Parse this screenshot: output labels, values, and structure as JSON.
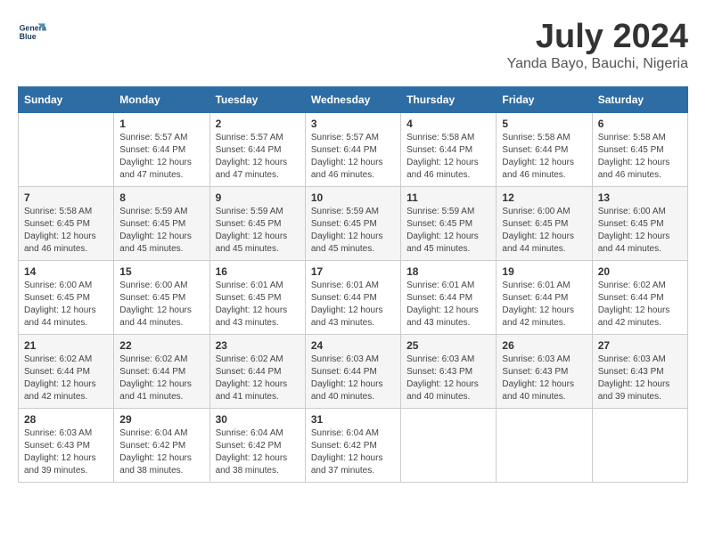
{
  "header": {
    "logo_line1": "General",
    "logo_line2": "Blue",
    "month_year": "July 2024",
    "location": "Yanda Bayo, Bauchi, Nigeria"
  },
  "weekdays": [
    "Sunday",
    "Monday",
    "Tuesday",
    "Wednesday",
    "Thursday",
    "Friday",
    "Saturday"
  ],
  "weeks": [
    [
      {
        "day": "",
        "sunrise": "",
        "sunset": "",
        "daylight": ""
      },
      {
        "day": "1",
        "sunrise": "Sunrise: 5:57 AM",
        "sunset": "Sunset: 6:44 PM",
        "daylight": "Daylight: 12 hours and 47 minutes."
      },
      {
        "day": "2",
        "sunrise": "Sunrise: 5:57 AM",
        "sunset": "Sunset: 6:44 PM",
        "daylight": "Daylight: 12 hours and 47 minutes."
      },
      {
        "day": "3",
        "sunrise": "Sunrise: 5:57 AM",
        "sunset": "Sunset: 6:44 PM",
        "daylight": "Daylight: 12 hours and 46 minutes."
      },
      {
        "day": "4",
        "sunrise": "Sunrise: 5:58 AM",
        "sunset": "Sunset: 6:44 PM",
        "daylight": "Daylight: 12 hours and 46 minutes."
      },
      {
        "day": "5",
        "sunrise": "Sunrise: 5:58 AM",
        "sunset": "Sunset: 6:44 PM",
        "daylight": "Daylight: 12 hours and 46 minutes."
      },
      {
        "day": "6",
        "sunrise": "Sunrise: 5:58 AM",
        "sunset": "Sunset: 6:45 PM",
        "daylight": "Daylight: 12 hours and 46 minutes."
      }
    ],
    [
      {
        "day": "7",
        "sunrise": "Sunrise: 5:58 AM",
        "sunset": "Sunset: 6:45 PM",
        "daylight": "Daylight: 12 hours and 46 minutes."
      },
      {
        "day": "8",
        "sunrise": "Sunrise: 5:59 AM",
        "sunset": "Sunset: 6:45 PM",
        "daylight": "Daylight: 12 hours and 45 minutes."
      },
      {
        "day": "9",
        "sunrise": "Sunrise: 5:59 AM",
        "sunset": "Sunset: 6:45 PM",
        "daylight": "Daylight: 12 hours and 45 minutes."
      },
      {
        "day": "10",
        "sunrise": "Sunrise: 5:59 AM",
        "sunset": "Sunset: 6:45 PM",
        "daylight": "Daylight: 12 hours and 45 minutes."
      },
      {
        "day": "11",
        "sunrise": "Sunrise: 5:59 AM",
        "sunset": "Sunset: 6:45 PM",
        "daylight": "Daylight: 12 hours and 45 minutes."
      },
      {
        "day": "12",
        "sunrise": "Sunrise: 6:00 AM",
        "sunset": "Sunset: 6:45 PM",
        "daylight": "Daylight: 12 hours and 44 minutes."
      },
      {
        "day": "13",
        "sunrise": "Sunrise: 6:00 AM",
        "sunset": "Sunset: 6:45 PM",
        "daylight": "Daylight: 12 hours and 44 minutes."
      }
    ],
    [
      {
        "day": "14",
        "sunrise": "Sunrise: 6:00 AM",
        "sunset": "Sunset: 6:45 PM",
        "daylight": "Daylight: 12 hours and 44 minutes."
      },
      {
        "day": "15",
        "sunrise": "Sunrise: 6:00 AM",
        "sunset": "Sunset: 6:45 PM",
        "daylight": "Daylight: 12 hours and 44 minutes."
      },
      {
        "day": "16",
        "sunrise": "Sunrise: 6:01 AM",
        "sunset": "Sunset: 6:45 PM",
        "daylight": "Daylight: 12 hours and 43 minutes."
      },
      {
        "day": "17",
        "sunrise": "Sunrise: 6:01 AM",
        "sunset": "Sunset: 6:44 PM",
        "daylight": "Daylight: 12 hours and 43 minutes."
      },
      {
        "day": "18",
        "sunrise": "Sunrise: 6:01 AM",
        "sunset": "Sunset: 6:44 PM",
        "daylight": "Daylight: 12 hours and 43 minutes."
      },
      {
        "day": "19",
        "sunrise": "Sunrise: 6:01 AM",
        "sunset": "Sunset: 6:44 PM",
        "daylight": "Daylight: 12 hours and 42 minutes."
      },
      {
        "day": "20",
        "sunrise": "Sunrise: 6:02 AM",
        "sunset": "Sunset: 6:44 PM",
        "daylight": "Daylight: 12 hours and 42 minutes."
      }
    ],
    [
      {
        "day": "21",
        "sunrise": "Sunrise: 6:02 AM",
        "sunset": "Sunset: 6:44 PM",
        "daylight": "Daylight: 12 hours and 42 minutes."
      },
      {
        "day": "22",
        "sunrise": "Sunrise: 6:02 AM",
        "sunset": "Sunset: 6:44 PM",
        "daylight": "Daylight: 12 hours and 41 minutes."
      },
      {
        "day": "23",
        "sunrise": "Sunrise: 6:02 AM",
        "sunset": "Sunset: 6:44 PM",
        "daylight": "Daylight: 12 hours and 41 minutes."
      },
      {
        "day": "24",
        "sunrise": "Sunrise: 6:03 AM",
        "sunset": "Sunset: 6:44 PM",
        "daylight": "Daylight: 12 hours and 40 minutes."
      },
      {
        "day": "25",
        "sunrise": "Sunrise: 6:03 AM",
        "sunset": "Sunset: 6:43 PM",
        "daylight": "Daylight: 12 hours and 40 minutes."
      },
      {
        "day": "26",
        "sunrise": "Sunrise: 6:03 AM",
        "sunset": "Sunset: 6:43 PM",
        "daylight": "Daylight: 12 hours and 40 minutes."
      },
      {
        "day": "27",
        "sunrise": "Sunrise: 6:03 AM",
        "sunset": "Sunset: 6:43 PM",
        "daylight": "Daylight: 12 hours and 39 minutes."
      }
    ],
    [
      {
        "day": "28",
        "sunrise": "Sunrise: 6:03 AM",
        "sunset": "Sunset: 6:43 PM",
        "daylight": "Daylight: 12 hours and 39 minutes."
      },
      {
        "day": "29",
        "sunrise": "Sunrise: 6:04 AM",
        "sunset": "Sunset: 6:42 PM",
        "daylight": "Daylight: 12 hours and 38 minutes."
      },
      {
        "day": "30",
        "sunrise": "Sunrise: 6:04 AM",
        "sunset": "Sunset: 6:42 PM",
        "daylight": "Daylight: 12 hours and 38 minutes."
      },
      {
        "day": "31",
        "sunrise": "Sunrise: 6:04 AM",
        "sunset": "Sunset: 6:42 PM",
        "daylight": "Daylight: 12 hours and 37 minutes."
      },
      {
        "day": "",
        "sunrise": "",
        "sunset": "",
        "daylight": ""
      },
      {
        "day": "",
        "sunrise": "",
        "sunset": "",
        "daylight": ""
      },
      {
        "day": "",
        "sunrise": "",
        "sunset": "",
        "daylight": ""
      }
    ]
  ]
}
